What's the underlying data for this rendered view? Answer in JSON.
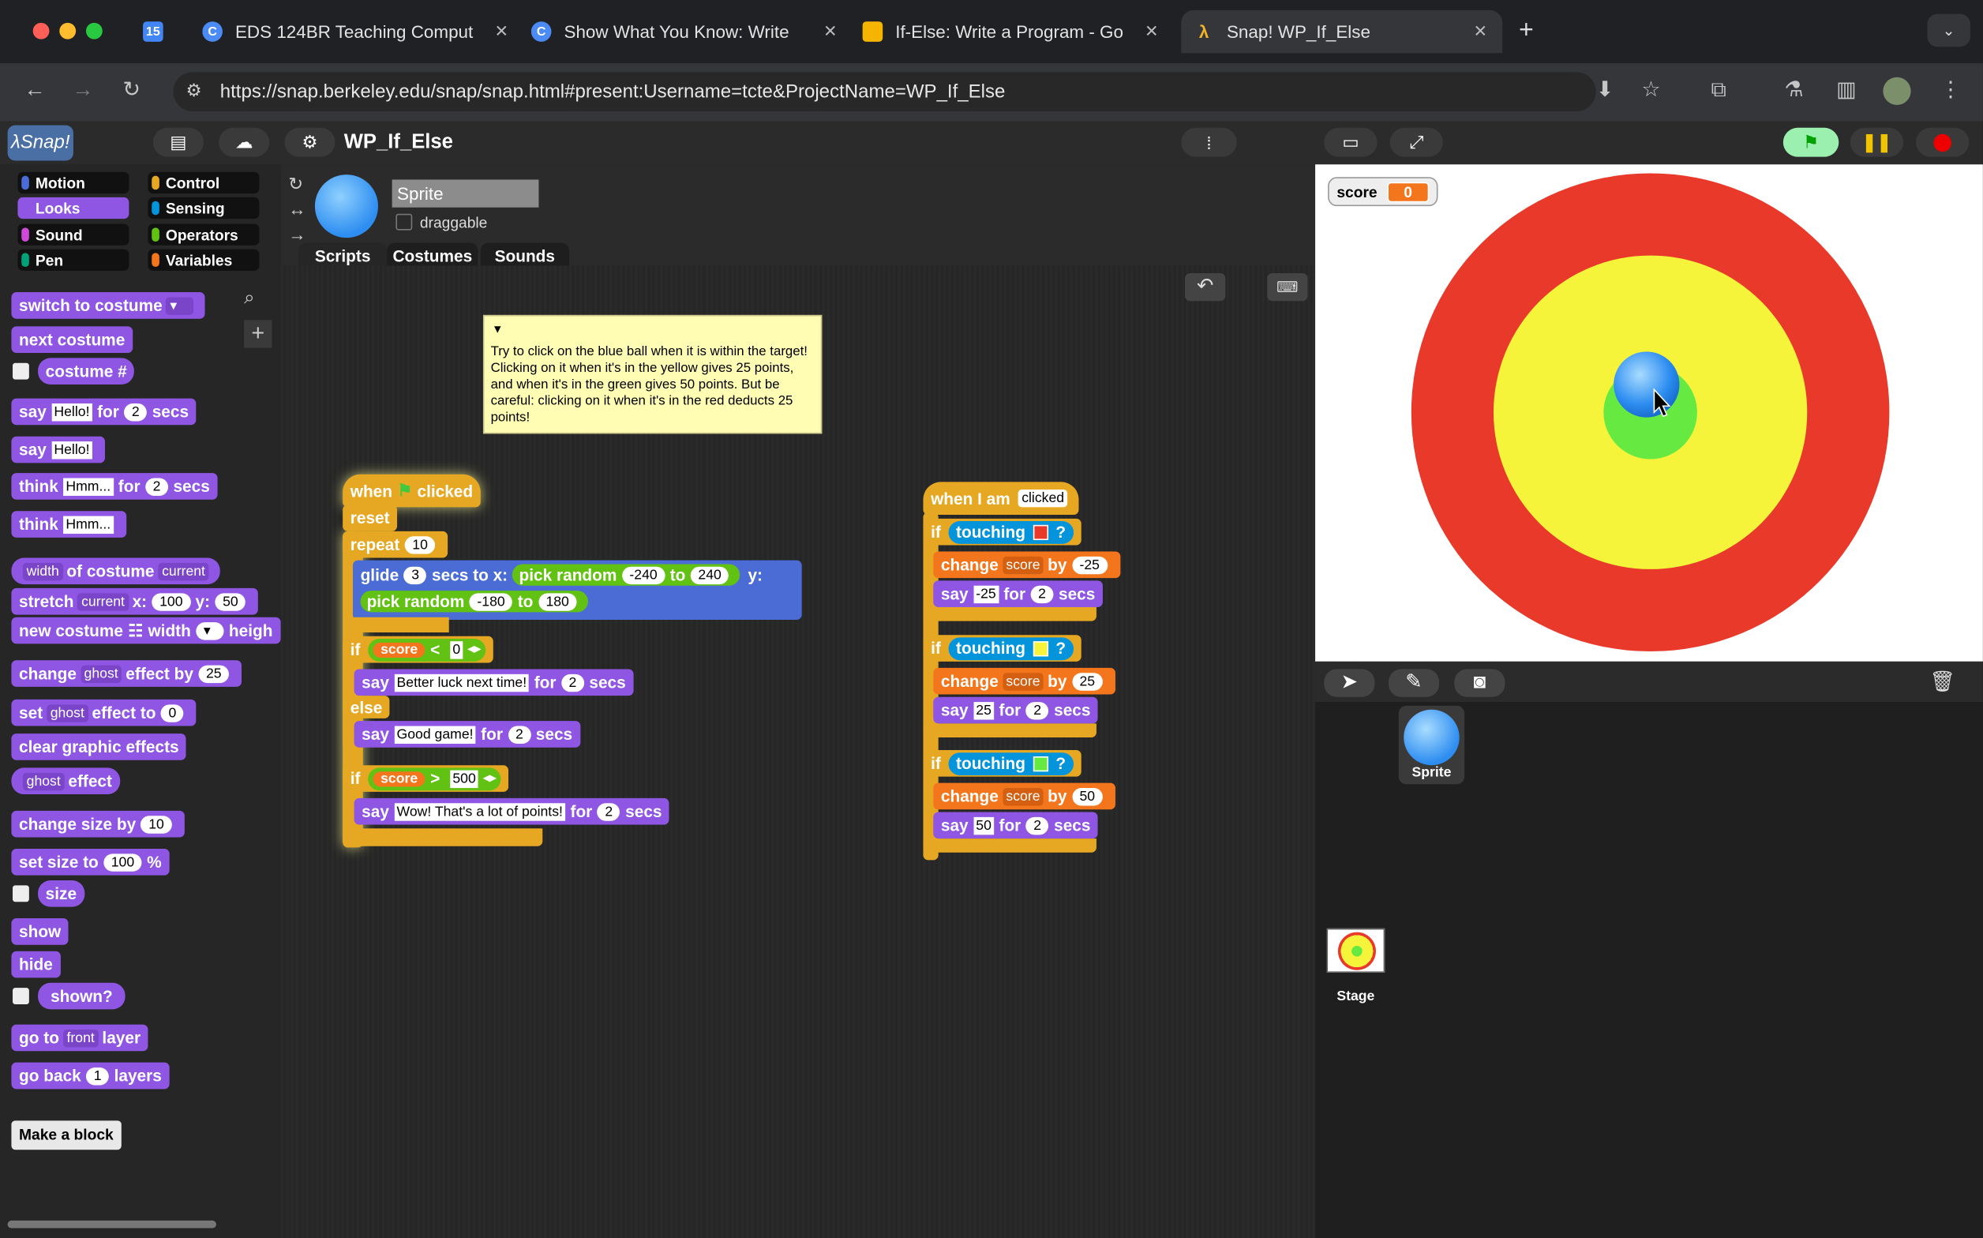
{
  "browser": {
    "tabs": [
      {
        "label": "",
        "active": false
      },
      {
        "label": "EDS 124BR Teaching Comput",
        "active": false
      },
      {
        "label": "Show What You Know: Write",
        "active": false
      },
      {
        "label": "If-Else: Write a Program - Go",
        "active": false
      },
      {
        "label": "Snap! WP_If_Else",
        "active": true
      }
    ],
    "url": "https://snap.berkeley.edu/snap/snap.html#present:Username=tcte&ProjectName=WP_If_Else"
  },
  "snap": {
    "project_name": "WP_If_Else",
    "categories": [
      "Motion",
      "Control",
      "Looks",
      "Sensing",
      "Sound",
      "Operators",
      "Pen",
      "Variables"
    ],
    "selected_category": "Looks",
    "sprite_name": "Sprite",
    "draggable_label": "draggable",
    "tabs": [
      "Scripts",
      "Costumes",
      "Sounds"
    ],
    "palette": {
      "switch_to_costume": "switch to costume",
      "next_costume": "next costume",
      "costume_num": "costume #",
      "say_for": {
        "a": "say",
        "v": "Hello!",
        "b": "for",
        "n": "2",
        "c": "secs"
      },
      "say": {
        "a": "say",
        "v": "Hello!"
      },
      "think_for": {
        "a": "think",
        "v": "Hmm...",
        "b": "for",
        "n": "2",
        "c": "secs"
      },
      "think": {
        "a": "think",
        "v": "Hmm..."
      },
      "attr": {
        "a": "width",
        "b": "of costume",
        "c": "current"
      },
      "stretch": {
        "a": "stretch",
        "b": "current",
        "c": "x:",
        "x": "100",
        "d": "y:",
        "y": "50"
      },
      "new_costume": {
        "a": "new costume",
        "b": "width",
        "c": "heigh"
      },
      "change_effect": {
        "a": "change",
        "b": "ghost",
        "c": "effect by",
        "n": "25"
      },
      "set_effect": {
        "a": "set",
        "b": "ghost",
        "c": "effect to",
        "n": "0"
      },
      "clear_effects": "clear graphic effects",
      "ghost_effect": {
        "a": "ghost",
        "b": "effect"
      },
      "change_size": {
        "a": "change size by",
        "n": "10"
      },
      "set_size": {
        "a": "set size to",
        "n": "100",
        "b": "%"
      },
      "size": "size",
      "show": "show",
      "hide": "hide",
      "shown": "shown?",
      "go_to_layer": {
        "a": "go to",
        "b": "front",
        "c": "layer"
      },
      "go_back": {
        "a": "go back",
        "n": "1",
        "b": "layers"
      },
      "make_block": "Make a block"
    },
    "comment": "Try to click on the blue ball when it is within the target! Clicking on it when it's in the yellow gives 25 points, and when it's in the green gives 50 points. But be careful: clicking on it when it's in the red deducts 25 points!",
    "script1": {
      "hat": {
        "a": "when",
        "b": "clicked"
      },
      "reset": "reset",
      "repeat": {
        "a": "repeat",
        "n": "10"
      },
      "glide": {
        "a": "glide",
        "n": "3",
        "b": "secs to x:",
        "pr": "pick random",
        "lo": "-240",
        "to": "to",
        "hi": "240",
        "y": "y:"
      },
      "glide2": {
        "pr": "pick random",
        "lo": "-180",
        "to": "to",
        "hi": "180"
      },
      "if1": {
        "a": "if",
        "v": "score",
        "op": "<",
        "n": "0"
      },
      "say1": {
        "a": "say",
        "t": "Better luck next time!",
        "b": "for",
        "n": "2",
        "c": "secs"
      },
      "else": "else",
      "say2": {
        "a": "say",
        "t": "Good game!",
        "b": "for",
        "n": "2",
        "c": "secs"
      },
      "if2": {
        "a": "if",
        "v": "score",
        "op": ">",
        "n": "500"
      },
      "say3": {
        "a": "say",
        "t": "Wow! That's a lot of points!",
        "b": "for",
        "n": "2",
        "c": "secs"
      }
    },
    "script2": {
      "hat": {
        "a": "when I am",
        "b": "clicked"
      },
      "if": "if",
      "touching": "touching",
      "q": "?",
      "change": "change",
      "var": "score",
      "by": "by",
      "say": "say",
      "for": "for",
      "secs": "secs",
      "two": "2",
      "v1": "-25",
      "v2": "25",
      "v3": "50",
      "colors": [
        "#e8392a",
        "#f6f33b",
        "#66ea42"
      ]
    },
    "stage": {
      "watcher_label": "score",
      "watcher_value": "0"
    },
    "corral": {
      "sprite": "Sprite",
      "stage": "Stage"
    }
  }
}
